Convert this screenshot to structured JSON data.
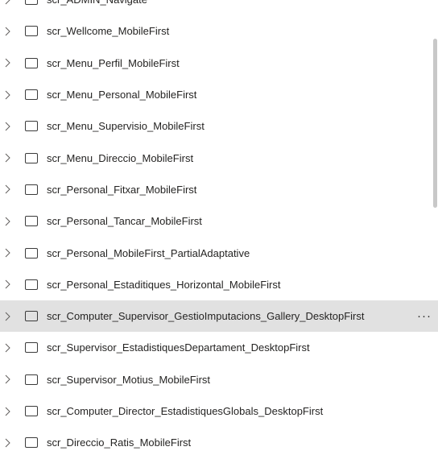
{
  "tree": {
    "items": [
      {
        "label": "scr_ADMIN_Navigate",
        "selected": false
      },
      {
        "label": "scr_Wellcome_MobileFirst",
        "selected": false
      },
      {
        "label": "scr_Menu_Perfil_MobileFirst",
        "selected": false
      },
      {
        "label": "scr_Menu_Personal_MobileFirst",
        "selected": false
      },
      {
        "label": "scr_Menu_Supervisio_MobileFirst",
        "selected": false
      },
      {
        "label": "scr_Menu_Direccio_MobileFirst",
        "selected": false
      },
      {
        "label": "scr_Personal_Fitxar_MobileFirst",
        "selected": false
      },
      {
        "label": "scr_Personal_Tancar_MobileFirst",
        "selected": false
      },
      {
        "label": "scr_Personal_MobileFirst_PartialAdaptative",
        "selected": false
      },
      {
        "label": "scr_Personal_Estaditiques_Horizontal_MobileFirst",
        "selected": false
      },
      {
        "label": "scr_Computer_Supervisor_GestioImputacions_Gallery_DesktopFirst",
        "selected": true
      },
      {
        "label": "scr_Supervisor_EstadistiquesDepartament_DesktopFirst",
        "selected": false
      },
      {
        "label": "scr_Supervisor_Motius_MobileFirst",
        "selected": false
      },
      {
        "label": "scr_Computer_Director_EstadistiquesGlobals_DesktopFirst",
        "selected": false
      },
      {
        "label": "scr_Direccio_Ratis_MobileFirst",
        "selected": false
      }
    ],
    "more_label": "···",
    "selected_bg": "#e1e1e1",
    "text_color": "#252423"
  }
}
